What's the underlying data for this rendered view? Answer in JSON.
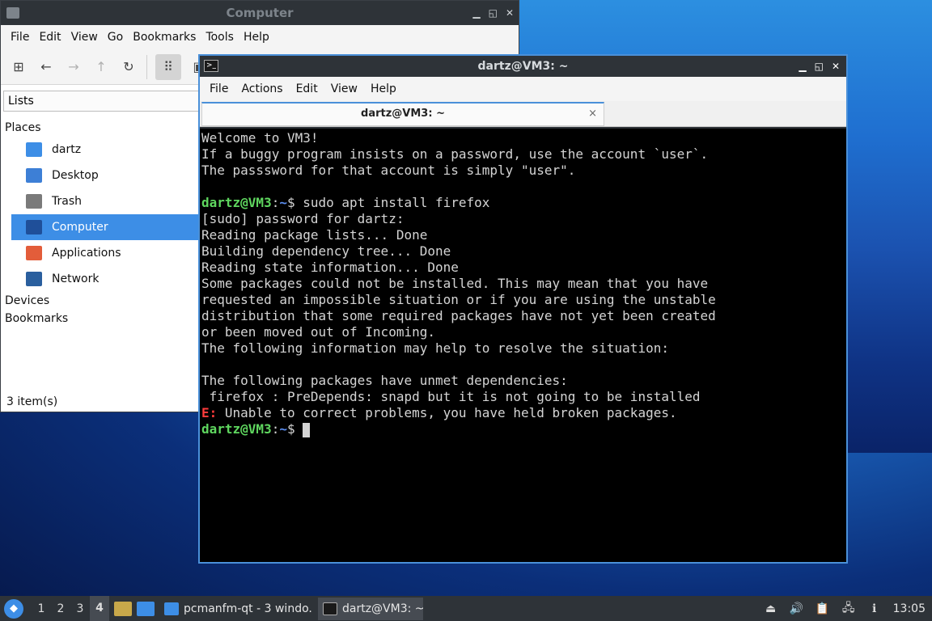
{
  "file_manager": {
    "title": "Computer",
    "menu": [
      "File",
      "Edit",
      "View",
      "Go",
      "Bookmarks",
      "Tools",
      "Help"
    ],
    "side_combo": "Lists",
    "places_label": "Places",
    "places": [
      {
        "label": "dartz",
        "icon": "home-folder-icon",
        "color": "#3d8ee6"
      },
      {
        "label": "Desktop",
        "icon": "desktop-icon",
        "color": "#3d7fd6"
      },
      {
        "label": "Trash",
        "icon": "trash-icon",
        "color": "#7a7a7a"
      },
      {
        "label": "Computer",
        "icon": "computer-icon",
        "color": "#1f4f99",
        "selected": true
      },
      {
        "label": "Applications",
        "icon": "applications-icon",
        "color": "#e35d3a"
      },
      {
        "label": "Network",
        "icon": "network-icon",
        "color": "#2a5f9e"
      }
    ],
    "devices_label": "Devices",
    "bookmarks_label": "Bookmarks",
    "status": "3 item(s)"
  },
  "terminal": {
    "title": "dartz@VM3: ~",
    "menu": [
      "File",
      "Actions",
      "Edit",
      "View",
      "Help"
    ],
    "tab_label": "dartz@VM3: ~",
    "tab_close": "×",
    "lines": [
      {
        "text": "Welcome to VM3!"
      },
      {
        "text": "If a buggy program insists on a password, use the account `user`."
      },
      {
        "text": "The passsword for that account is simply \"user\"."
      },
      {
        "text": ""
      },
      {
        "prompt_user": "dartz@VM3",
        "prompt_sep": ":",
        "prompt_path": "~",
        "text": "$ sudo apt install firefox"
      },
      {
        "text": "[sudo] password for dartz:"
      },
      {
        "text": "Reading package lists... Done"
      },
      {
        "text": "Building dependency tree... Done"
      },
      {
        "text": "Reading state information... Done"
      },
      {
        "text": "Some packages could not be installed. This may mean that you have"
      },
      {
        "text": "requested an impossible situation or if you are using the unstable"
      },
      {
        "text": "distribution that some required packages have not yet been created"
      },
      {
        "text": "or been moved out of Incoming."
      },
      {
        "text": "The following information may help to resolve the situation:"
      },
      {
        "text": ""
      },
      {
        "text": "The following packages have unmet dependencies:"
      },
      {
        "text": " firefox : PreDepends: snapd but it is not going to be installed"
      },
      {
        "error_prefix": "E:",
        "text": " Unable to correct problems, you have held broken packages."
      },
      {
        "prompt_user": "dartz@VM3",
        "prompt_sep": ":",
        "prompt_path": "~",
        "text": "$ ",
        "cursor": true
      }
    ]
  },
  "taskbar": {
    "workspaces": [
      "1",
      "2",
      "3",
      "4"
    ],
    "active_workspace": "4",
    "tasks": [
      {
        "label": "pcmanfm-qt - 3 windo...",
        "icon": "folder-icon"
      },
      {
        "label": "dartz@VM3: ~",
        "icon": "terminal-icon",
        "active": true
      }
    ],
    "clock": "13:05"
  },
  "colors": {
    "accent": "#3d8ee6",
    "prompt_user": "#5fd75f",
    "prompt_path": "#5b8ef0",
    "error": "#ff3b3b"
  }
}
